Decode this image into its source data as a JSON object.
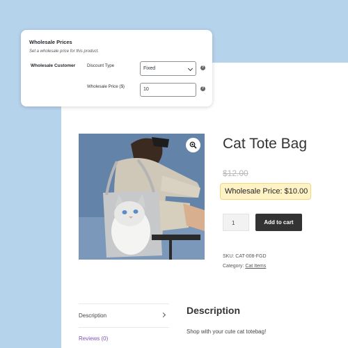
{
  "admin": {
    "title": "Wholesale Prices",
    "subtitle": "Set a wholesale price for this product.",
    "role_label": "Wholesale Customer",
    "discount_type_label": "Discount Type",
    "discount_type_value": "Fixed",
    "price_label": "Wholesale Price ($)",
    "price_value": "10",
    "help_glyph": "?"
  },
  "product": {
    "title": "Cat Tote Bag",
    "regular_price": "$12.00",
    "wholesale_price": "Wholesale Price: $10.00",
    "quantity": "1",
    "add_to_cart": "Add to cart",
    "sku": "SKU: CAT-008-FGD",
    "category_label": "Category:",
    "category": "Cat Items"
  },
  "tabs": {
    "description": "Description",
    "reviews": "Reviews (0)"
  },
  "description": {
    "heading": "Description",
    "text": "Shop with your cute cat totebag!"
  },
  "colors": {
    "background": "#b6d3ec",
    "badge_bg": "#fff3c6",
    "button": "#333333",
    "link_purple": "#7f54b3"
  }
}
